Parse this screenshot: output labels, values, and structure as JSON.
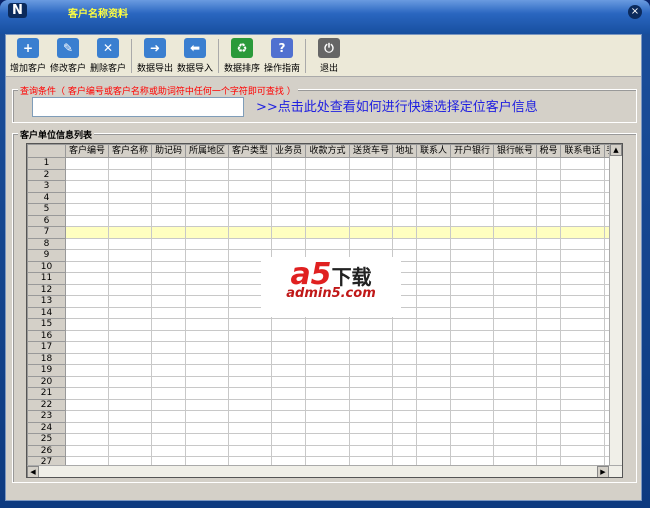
{
  "window": {
    "title": "客户名称资料",
    "logo": "N",
    "close": "×"
  },
  "toolbar": [
    {
      "label": "增加客户",
      "icon": "folder-add-icon",
      "color": "#3a7fd0",
      "glyph": "+"
    },
    {
      "label": "修改客户",
      "icon": "edit-icon",
      "color": "#3a7fd0",
      "glyph": "✎"
    },
    {
      "label": "删除客户",
      "icon": "folder-delete-icon",
      "color": "#3a7fd0",
      "glyph": "✕"
    },
    {
      "label": "数据导出",
      "icon": "export-icon",
      "color": "#3a7fd0",
      "glyph": "➜"
    },
    {
      "label": "数据导入",
      "icon": "import-icon",
      "color": "#3a7fd0",
      "glyph": "⬅"
    },
    {
      "label": "数据排序",
      "icon": "recycle-sort-icon",
      "color": "#2a9a3a",
      "glyph": "♻"
    },
    {
      "label": "操作指南",
      "icon": "help-icon",
      "color": "#5070d0",
      "glyph": "?"
    },
    {
      "label": "退出",
      "icon": "exit-icon",
      "color": "#666666",
      "glyph": "⏻"
    }
  ],
  "search": {
    "legend": "查询条件（ 客户编号或客户名称或助词符中任何一个字符即可查找 ）",
    "value": "",
    "hint": ">>点击此处查看如何进行快速选择定位客户信息"
  },
  "list": {
    "legend": "客户单位信息列表",
    "columns": [
      "客户编号",
      "客户名称",
      "助记码",
      "所属地区",
      "客户类型",
      "业务员",
      "收款方式",
      "送货车号",
      "地址",
      "联系人",
      "开户银行",
      "银行帐号",
      "税号",
      "联系电话",
      "手"
    ],
    "rows": [
      "1",
      "2",
      "3",
      "4",
      "5",
      "6",
      "7",
      "8",
      "9",
      "10",
      "11",
      "12",
      "13",
      "14",
      "15",
      "16",
      "17",
      "18",
      "19",
      "20",
      "21",
      "22",
      "23",
      "24",
      "25",
      "26",
      "27"
    ],
    "selected_row": "7"
  },
  "watermark": {
    "logo": "a5",
    "text": "下载",
    "url": "admin5.com"
  }
}
